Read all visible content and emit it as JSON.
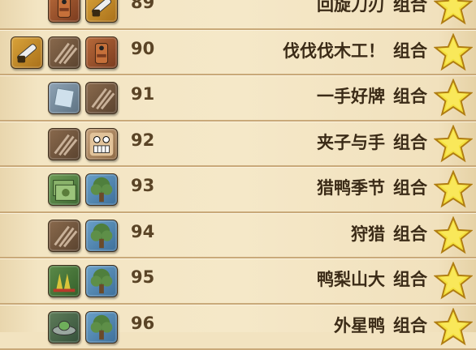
{
  "combo_suffix": "组合",
  "rows": [
    {
      "number": "89",
      "title": "回旋刀刃",
      "icons": [
        {
          "name": "robot-head-icon",
          "theme": "t-robot"
        },
        {
          "name": "chainsaw-icon",
          "theme": "t-saw"
        }
      ]
    },
    {
      "number": "90",
      "title": "伐伐伐木工！",
      "icons": [
        {
          "name": "chainsaw-icon",
          "theme": "t-saw"
        },
        {
          "name": "sticks-icon",
          "theme": "t-stick"
        },
        {
          "name": "robot-head-icon",
          "theme": "t-robot"
        }
      ]
    },
    {
      "number": "91",
      "title": "一手好牌",
      "icons": [
        {
          "name": "glass-icon",
          "theme": "t-glass"
        },
        {
          "name": "sticks-icon",
          "theme": "t-stick"
        }
      ]
    },
    {
      "number": "92",
      "title": "夹子与手",
      "icons": [
        {
          "name": "sticks-icon",
          "theme": "t-stick"
        },
        {
          "name": "grinning-face-icon",
          "theme": "t-face"
        }
      ]
    },
    {
      "number": "93",
      "title": "猎鸭季节",
      "icons": [
        {
          "name": "duck-cards-icon",
          "theme": "t-duck"
        },
        {
          "name": "tree-icon",
          "theme": "t-tree"
        }
      ]
    },
    {
      "number": "94",
      "title": "狩猎",
      "icons": [
        {
          "name": "sticks-icon",
          "theme": "t-stick"
        },
        {
          "name": "tree-icon",
          "theme": "t-tree"
        }
      ]
    },
    {
      "number": "95",
      "title": "鸭梨山大",
      "icons": [
        {
          "name": "pear-icon",
          "theme": "t-pear"
        },
        {
          "name": "tree-icon",
          "theme": "t-tree"
        }
      ]
    },
    {
      "number": "96",
      "title": "外星鸭",
      "icons": [
        {
          "name": "ufo-icon",
          "theme": "t-ufo"
        },
        {
          "name": "tree-icon",
          "theme": "t-tree"
        }
      ]
    }
  ]
}
